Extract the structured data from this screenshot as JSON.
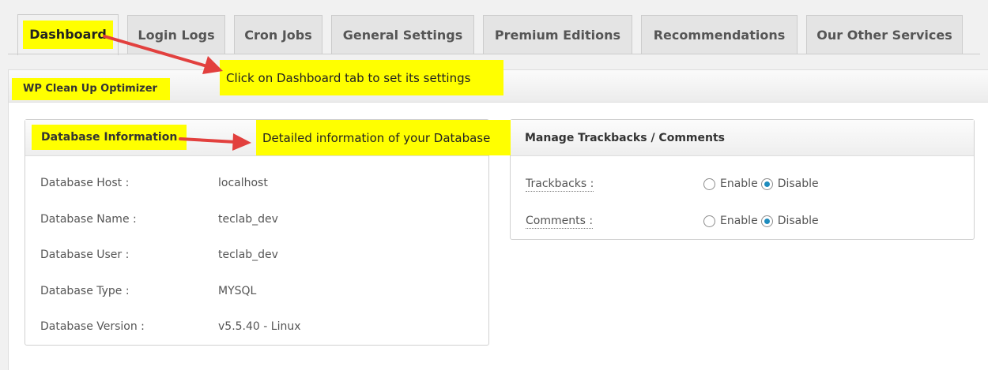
{
  "tabs": [
    {
      "label": "Dashboard",
      "active": true
    },
    {
      "label": "Login Logs"
    },
    {
      "label": "Cron Jobs"
    },
    {
      "label": "General Settings"
    },
    {
      "label": "Premium Editions"
    },
    {
      "label": "Recommendations"
    },
    {
      "label": "Our Other Services"
    }
  ],
  "panel": {
    "title": "WP Clean Up Optimizer"
  },
  "db_info": {
    "title": "Database Information",
    "rows": [
      {
        "label": "Database Host :",
        "value": "localhost"
      },
      {
        "label": "Database Name :",
        "value": "teclab_dev"
      },
      {
        "label": "Database User :",
        "value": "teclab_dev"
      },
      {
        "label": "Database Type :",
        "value": "MYSQL"
      },
      {
        "label": "Database Version :",
        "value": "v5.5.40 - Linux"
      }
    ]
  },
  "trackbacks_box": {
    "title": "Manage Trackbacks / Comments",
    "rows": [
      {
        "label": "Trackbacks :",
        "enable_label": "Enable",
        "disable_label": "Disable",
        "selected": "Disable"
      },
      {
        "label": "Comments :",
        "enable_label": "Enable",
        "disable_label": "Disable",
        "selected": "Disable"
      }
    ]
  },
  "annotations": {
    "dashboard_callout": "Click on Dashboard tab to set its settings",
    "database_callout": "Detailed information of your Database"
  },
  "colors": {
    "highlight": "#ffff00",
    "arrow": "#e2403e",
    "radio_checked": "#1e8cbe"
  }
}
